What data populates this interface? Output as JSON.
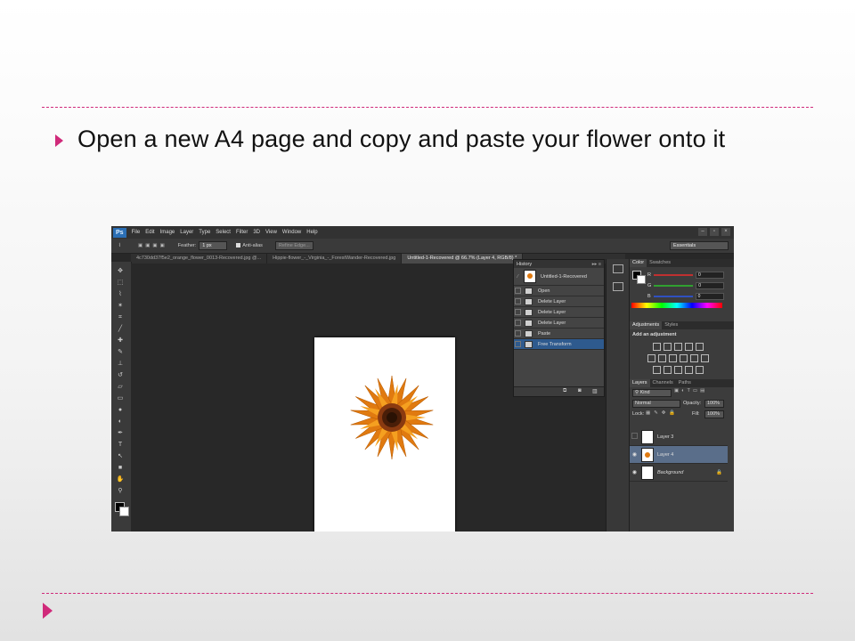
{
  "slide": {
    "text": "Open a new A4 page and copy and paste your flower onto it",
    "accent_color": "#d02a7a"
  },
  "photoshop": {
    "logo": "Ps",
    "menu": [
      "File",
      "Edit",
      "Image",
      "Layer",
      "Type",
      "Select",
      "Filter",
      "3D",
      "View",
      "Window",
      "Help"
    ],
    "options": {
      "feather_label": "Feather:",
      "feather_value": "1 px",
      "anti_alias_label": "Anti-alias",
      "refine_edge_label": "Refine Edge...",
      "workspace": "Essentials"
    },
    "tabs": [
      "4c730dd37f5e2_orange_flower_0013-Recovered.jpg @...",
      "Hippie-flower_-_Virginia_-_ForestWander-Recovered.jpg",
      "Untitled-1-Recovered @ 66.7% (Layer 4, RGB/8) *"
    ],
    "history": {
      "title": "History",
      "snapshot": "Untitled-1-Recovered",
      "steps": [
        "Open",
        "Delete Layer",
        "Delete Layer",
        "Delete Layer",
        "Paste",
        "Free Transform"
      ],
      "selected_index": 5
    },
    "color_panel": {
      "tabs": [
        "Color",
        "Swatches"
      ],
      "channels": [
        {
          "label": "R",
          "value": "0",
          "color": "#c03030"
        },
        {
          "label": "G",
          "value": "0",
          "color": "#30a030"
        },
        {
          "label": "B",
          "value": "0",
          "color": "#3050c0"
        }
      ]
    },
    "adjustments": {
      "tabs": [
        "Adjustments",
        "Styles"
      ],
      "heading": "Add an adjustment"
    },
    "layers_panel": {
      "tabs": [
        "Layers",
        "Channels",
        "Paths"
      ],
      "filter_label": "Kind",
      "blend_mode": "Normal",
      "opacity_label": "Opacity:",
      "opacity_value": "100%",
      "lock_label": "Lock:",
      "fill_label": "Fill:",
      "fill_value": "100%",
      "layers": [
        {
          "name": "Layer 3",
          "visible": false,
          "selected": false
        },
        {
          "name": "Layer 4",
          "visible": true,
          "selected": true
        },
        {
          "name": "Background",
          "visible": true,
          "selected": false
        }
      ]
    }
  }
}
